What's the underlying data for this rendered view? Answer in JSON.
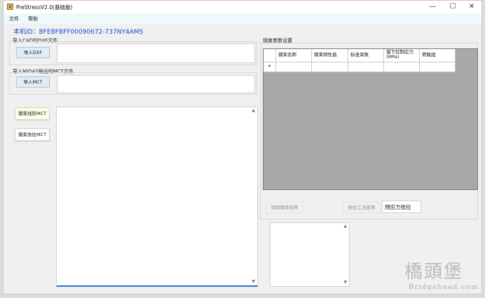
{
  "window": {
    "title": "PreStressV2.0(基础版)",
    "controls": {
      "minimize": "—",
      "maximize": "☐",
      "close": "✕"
    }
  },
  "menu": {
    "items": [
      "文件",
      "帮助"
    ]
  },
  "machine_id": "本机ID：BFEBFBFF00090672-737NY4AMS",
  "dxf_section": {
    "label": "导入CAD的DXF文件",
    "button": "导入DXF",
    "value": ""
  },
  "mct_section": {
    "label": "导入MIDAS输出的MCT文件",
    "button": "导入MCT",
    "value": ""
  },
  "actions": {
    "shape_button": "钢束线形MCT",
    "tension_button": "钢束张拉MCT"
  },
  "params": {
    "title": "钢束参数设置",
    "columns": [
      "钢束名称",
      "钢束特性值",
      "标准束数",
      "锚下控制应力(MPa)",
      "荷载组"
    ],
    "new_row_marker": "*",
    "read_button": "读取钢束名称",
    "tension_case_button": "张拉工况名称",
    "tension_case_value": "预应力张拉"
  },
  "icons": {
    "app": "app-icon",
    "scroll_up": "scroll-up-icon",
    "scroll_down": "scroll-down-icon"
  },
  "watermark": {
    "cn": "橋頭堡",
    "en": "Bridgehead.com.cn"
  }
}
